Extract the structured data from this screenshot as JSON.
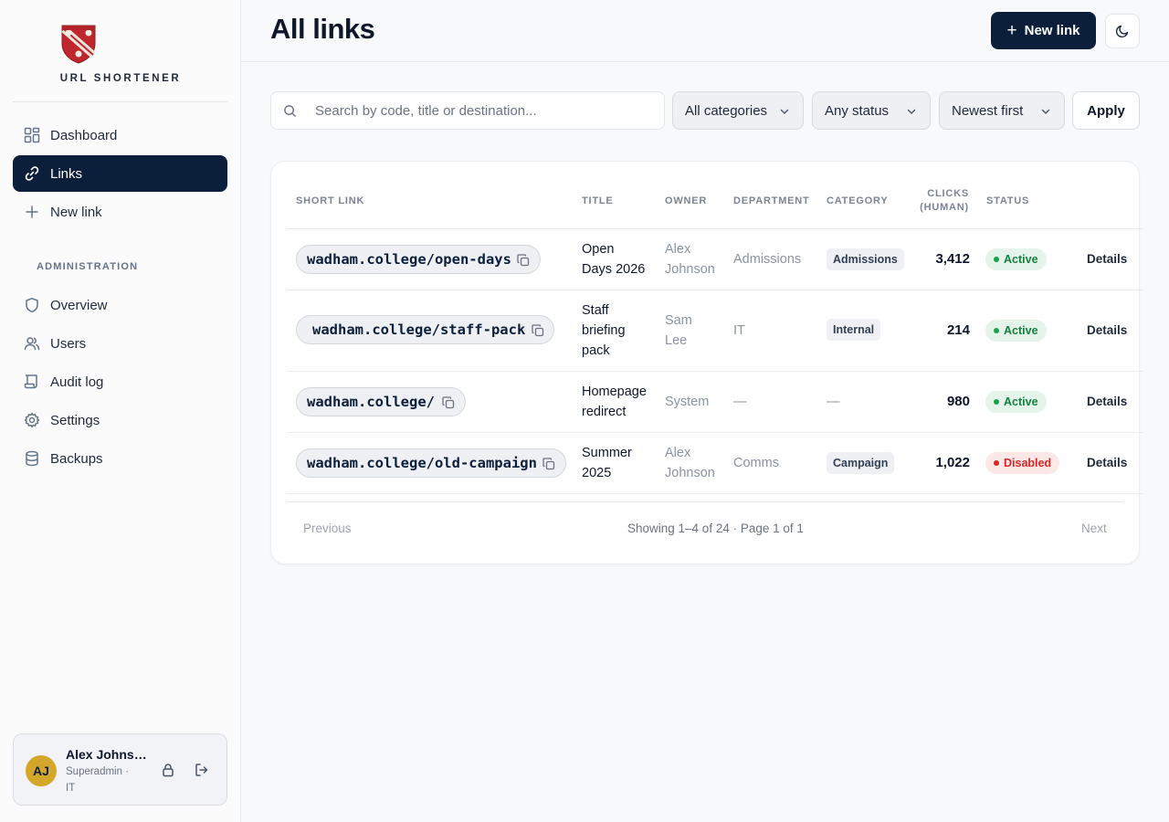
{
  "brand": {
    "name": "URL SHORTENER",
    "logo_icon": "college-crest-icon"
  },
  "sidebar": {
    "items": [
      {
        "label": "Dashboard",
        "icon": "dashboard-icon"
      },
      {
        "label": "Links",
        "icon": "link-icon",
        "active": true
      },
      {
        "label": "New link",
        "icon": "plus-icon"
      }
    ],
    "admin_label": "ADMINISTRATION",
    "admin_items": [
      {
        "label": "Overview",
        "icon": "shield-icon"
      },
      {
        "label": "Users",
        "icon": "users-icon"
      },
      {
        "label": "Audit log",
        "icon": "scroll-icon"
      },
      {
        "label": "Settings",
        "icon": "gear-icon"
      },
      {
        "label": "Backups",
        "icon": "database-icon"
      }
    ]
  },
  "user": {
    "initials": "AJ",
    "name": "Alex Johnson",
    "role": "Superadmin · IT"
  },
  "header": {
    "title": "All links",
    "new_link_label": "New link"
  },
  "filters": {
    "search_placeholder": "Search by code, title or destination...",
    "category": "All categories",
    "status": "Any status",
    "sort": "Newest first",
    "apply_label": "Apply"
  },
  "table": {
    "headers": {
      "short_link": "SHORT LINK",
      "title": "TITLE",
      "owner": "OWNER",
      "department": "DEPARTMENT",
      "category": "CATEGORY",
      "clicks_line1": "CLICKS",
      "clicks_line2": "(HUMAN)",
      "status": "STATUS"
    },
    "rows": [
      {
        "short_link": "wadham.college/open-days",
        "title_l1": "Open",
        "title_l2": "Days 2026",
        "title_l3": "",
        "owner_l1": "Alex",
        "owner_l2": "Johnson",
        "department": "Admissions",
        "category": "Admissions",
        "clicks": "3,412",
        "status": "Active",
        "details": "Details"
      },
      {
        "short_link": "wadham.college/staff-pack",
        "title_l1": "Staff",
        "title_l2": "briefing",
        "title_l3": "pack",
        "owner_l1": "Sam",
        "owner_l2": "Lee",
        "department": "IT",
        "category": "Internal",
        "clicks": "214",
        "status": "Active",
        "details": "Details"
      },
      {
        "short_link": "wadham.college/",
        "title_l1": "Homepage",
        "title_l2": "redirect",
        "title_l3": "",
        "owner_l1": "System",
        "owner_l2": "",
        "department": "—",
        "category": "—",
        "clicks": "980",
        "status": "Active",
        "details": "Details"
      },
      {
        "short_link": "wadham.college/old-campaign",
        "title_l1": "Summer",
        "title_l2": "2025",
        "title_l3": "",
        "owner_l1": "Alex",
        "owner_l2": "Johnson",
        "department": "Comms",
        "category": "Campaign",
        "clicks": "1,022",
        "status": "Disabled",
        "details": "Details"
      }
    ]
  },
  "pagination": {
    "previous": "Previous",
    "info": "Showing 1–4 of 24 · Page 1 of 1",
    "next": "Next"
  },
  "colors": {
    "navy": "#0b1f3b",
    "active_green": "#15803d",
    "disabled_red": "#dc2626",
    "gold": "#d4a62a"
  }
}
